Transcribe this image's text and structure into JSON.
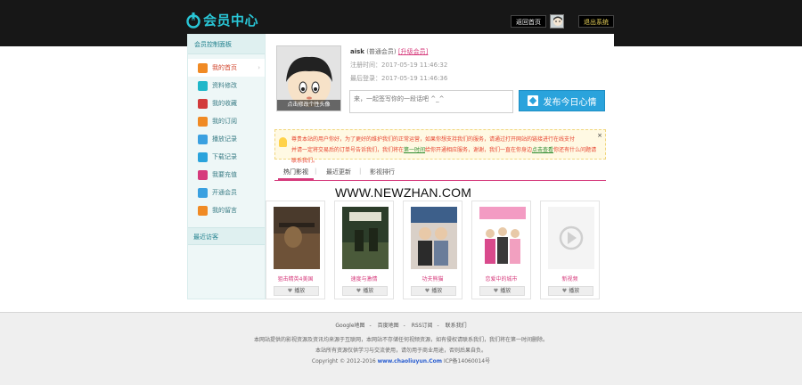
{
  "header": {
    "title": "会员中心",
    "home_btn": "返回首页",
    "logout_btn": "退出系统"
  },
  "sidebar": {
    "panel_title": "会员控制面板",
    "items": [
      {
        "label": "我的首页",
        "icon": "home-icon",
        "color": "#f08a24"
      },
      {
        "label": "资料修改",
        "icon": "user-edit-icon",
        "color": "#1fb7c9"
      },
      {
        "label": "我的收藏",
        "icon": "heart-icon",
        "color": "#d23b3b"
      },
      {
        "label": "我的订阅",
        "icon": "rss-icon",
        "color": "#f08a24"
      },
      {
        "label": "播放记录",
        "icon": "chat-icon",
        "color": "#3aa0e0"
      },
      {
        "label": "下载记录",
        "icon": "download-icon",
        "color": "#2aa3dc"
      },
      {
        "label": "我要充值",
        "icon": "coin-icon",
        "color": "#d63b7c"
      },
      {
        "label": "开通会员",
        "icon": "vip-icon",
        "color": "#3aa0e0"
      },
      {
        "label": "我的留言",
        "icon": "message-icon",
        "color": "#f08a24"
      }
    ],
    "recent_title": "最近访客"
  },
  "profile": {
    "avatar_caption": "点击修改个性头像",
    "username": "aisk",
    "group": "(普通会员)",
    "upgrade_link": "[升级会员]",
    "reg_time": "注册时间：2017-05-19 11:46:32",
    "last_login": "最后登录：2017-05-19 11:46:36",
    "mood_placeholder": "来，一起签写你的一段话吧 ^_^",
    "mood_button": "发布今日心情"
  },
  "notice": {
    "line1": "尊贵本站的用户你好，为了更好的维护我们的正常运营，如果你想支持我们的服务，请通过打开网站的链接进行在线支付",
    "line2a": "并请一定将交易后的订单号告诉我们，我们将在",
    "line2_link": "第一时间",
    "line2b": "给你开通相应服务，谢谢，我们一直在你身边",
    "line2_link2": "点击查看",
    "line2c": "你还有什么问题请联系我们。"
  },
  "tabs": [
    "热门影视",
    "最近更新",
    "影视排行"
  ],
  "watermark": "WWW.NEWZHAN.COM",
  "movies": [
    {
      "title": "狙击精英4美国",
      "btn": "播放",
      "poster_a": "#4a3a2c",
      "poster_b": "#8a6a46"
    },
    {
      "title": "速度与激情",
      "btn": "播放",
      "poster_a": "#2c3d2a",
      "poster_b": "#7a8a5a"
    },
    {
      "title": "功夫熊猫",
      "btn": "播放",
      "poster_a": "#3d5f8a",
      "poster_b": "#d9d0c8"
    },
    {
      "title": "恋爱中的城市",
      "btn": "播放",
      "poster_a": "#f39bc3",
      "poster_b": "#ffffff"
    },
    {
      "title": "新视频",
      "btn": "播放",
      "poster_a": "#f4f4f4",
      "poster_b": "#dcdcdc"
    }
  ],
  "footer": {
    "links": [
      "Google地图",
      "百度地图",
      "RSS订阅",
      "联系我们"
    ],
    "line1": "本网站提供的影视资源及资讯均来源于互联网，本网站不存储任何视频资源，如有侵权请联系我们，我们将在第一时间删除。",
    "line2": "本站所有资源仅供学习与交流使用，请勿用于商业用途，否则后果自负。",
    "copyright_pre": "Copyright © 2012-2016",
    "site": "www.chaoliuyun.Com",
    "icp": "ICP备14060014号"
  },
  "colors": {
    "brand": "#29c6d6",
    "accent": "#d63b7c",
    "button_blue": "#2aa3dc"
  }
}
